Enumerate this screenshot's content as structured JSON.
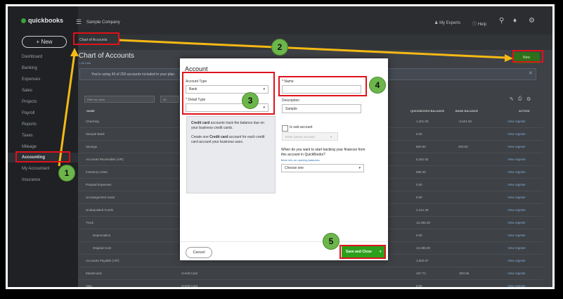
{
  "app": {
    "logo": "quickbooks",
    "company": "Sample Company",
    "new_button": "+ New",
    "my_experts": "My Experts",
    "help": "Help",
    "breadcrumb": "Chart of Accounts"
  },
  "sidebar": {
    "items": [
      "Dashboard",
      "Banking",
      "Expenses",
      "Sales",
      "Projects",
      "Payroll",
      "Reports",
      "Taxes",
      "Mileage",
      "Accounting",
      "My Accountant",
      "Insurance"
    ]
  },
  "page": {
    "title": "Chart of Accounts",
    "all_lists": "< All Lists",
    "new_button": "New",
    "banner": "You're using 43 of 250 accounts included in your plan.",
    "filter_placeholder": "Filter by name",
    "filter_all": "All"
  },
  "table": {
    "headers": [
      "NAME",
      "QUICKBOOKS BALANCE",
      "BANK BALANCE",
      "ACTION"
    ],
    "rows": [
      {
        "name": "Checking",
        "type": "",
        "qb": "1,201.00",
        "bank": "-3,621.93",
        "action": "View register"
      },
      {
        "name": "Sample Bank",
        "type": "",
        "qb": "0.00",
        "bank": "",
        "action": "View register"
      },
      {
        "name": "Savings",
        "type": "",
        "qb": "800.00",
        "bank": "200.00",
        "action": "View register"
      },
      {
        "name": "Accounts Receivable (A/R)",
        "type": "",
        "qb": "5,281.52",
        "bank": "",
        "action": "View register"
      },
      {
        "name": "Inventory Asset",
        "type": "",
        "qb": "596.25",
        "bank": "",
        "action": "View register"
      },
      {
        "name": "Prepaid Expenses",
        "type": "",
        "qb": "0.00",
        "bank": "",
        "action": "View register"
      },
      {
        "name": "Uncategorized Asset",
        "type": "",
        "qb": "0.00",
        "bank": "",
        "action": "View register"
      },
      {
        "name": "Undeposited Funds",
        "type": "",
        "qb": "4,441.28",
        "bank": "",
        "action": "View register"
      },
      {
        "name": "Truck",
        "type": "",
        "qb": "13,495.00",
        "bank": "",
        "action": "View register"
      },
      {
        "name": "Depreciation",
        "type": "",
        "qb": "0.00",
        "bank": "",
        "action": "View register"
      },
      {
        "name": "Original Cost",
        "type": "",
        "qb": "13,495.00",
        "bank": "",
        "action": "View register"
      },
      {
        "name": "Accounts Payable (A/P)",
        "type": "",
        "qb": "1,602.67",
        "bank": "",
        "action": "View register"
      },
      {
        "name": "Mastercard",
        "type": "Credit Card",
        "qb": "157.72",
        "bank": "-304.96",
        "action": "View register"
      },
      {
        "name": "Visa",
        "type": "Credit Card",
        "qb": "0.00",
        "bank": "",
        "action": "View register"
      }
    ]
  },
  "modal": {
    "title": "Account",
    "account_type_label": "Account Type",
    "account_type_value": "Bank",
    "detail_type_label": "* Detail Type",
    "detail_type_value": "",
    "name_label": "* Name",
    "name_value": "",
    "description_label": "Description",
    "description_value": "Sample",
    "help_p1_bold": "Credit card",
    "help_p1": " accounts track the balance due on your business credit cards.",
    "help_p2_pre": "Create one ",
    "help_p2_bold": "Credit card",
    "help_p2": " account for each credit card account your business uses.",
    "sub_account_label": "Is sub-account",
    "parent_placeholder": "Enter parent account",
    "question": "When do you want to start tracking your finances from this account in QuickBooks?",
    "more_info": "More info on opening balances",
    "choose_one": "Choose one",
    "cancel": "Cancel",
    "save_and_close": "Save and Close"
  },
  "annotations": {
    "steps": [
      "1",
      "2",
      "3",
      "4",
      "5"
    ],
    "highlight_color": "#e0121b",
    "badge_color": "#6cb64b",
    "arrow_color": "#f5b915"
  }
}
